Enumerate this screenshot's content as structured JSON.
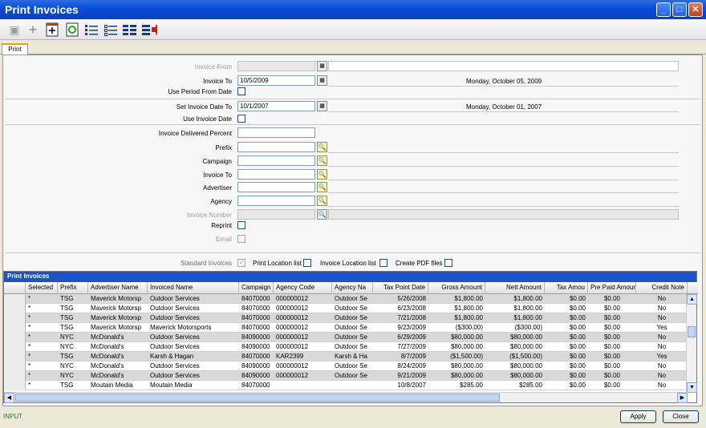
{
  "window": {
    "title": "Print Invoices"
  },
  "tab": {
    "label": "Print"
  },
  "form": {
    "invoice_from_label": "Invoice From",
    "invoice_to_label": "Invoice To",
    "invoice_to_value": "10/5/2009",
    "invoice_to_text": "Monday, October 05, 2009",
    "use_period_label": "Use Period From Date",
    "set_invoice_date_label": "Set Invoice Date To",
    "set_invoice_date_value": "10/1/2007",
    "set_invoice_date_text": "Monday, October 01, 2007",
    "use_invoice_date_label": "Use Invoice Date",
    "delivered_percent_label": "Invoice Delivered Percent",
    "prefix_label": "Prefix",
    "campaign_label": "Campaign",
    "invoice_to2_label": "Invoice To",
    "advertiser_label": "Advertiser",
    "agency_label": "Agency",
    "invoice_number_label": "Invoice Number",
    "reprint_label": "Reprint",
    "email_label": "Email",
    "standard_invoices_label": "Standard Invoices",
    "print_location_label": "Print Location list",
    "invoice_location_label": "Invoice Location list",
    "create_pdf_label": "Create PDF files"
  },
  "grid": {
    "title": "Print Invoices",
    "columns": [
      "Selected",
      "Prefix",
      "Advertiser Name",
      "Invoiced Name",
      "Campaign",
      "Agency Code",
      "Agency Na",
      "Tax Point Date",
      "Gross Amount",
      "Nett Amount",
      "Tax Amou",
      "Pre Paid Amount",
      "Credit Note"
    ],
    "rows": [
      [
        "*",
        "TSG",
        "Maverick Motorsp",
        "Outdoor Services",
        "84070000",
        "000000012",
        "Outdoor Se",
        "5/26/2008",
        "$1,800.00",
        "$1,800.00",
        "$0.00",
        "$0.00",
        "No"
      ],
      [
        "*",
        "TSG",
        "Maverick Motorsp",
        "Outdoor Services",
        "84070000",
        "000000012",
        "Outdoor Se",
        "6/23/2008",
        "$1,800.00",
        "$1,800.00",
        "$0.00",
        "$0.00",
        "No"
      ],
      [
        "*",
        "TSG",
        "Maverick Motorsp",
        "Outdoor Services",
        "84070000",
        "000000012",
        "Outdoor Se",
        "7/21/2008",
        "$1,800.00",
        "$1,800.00",
        "$0.00",
        "$0.00",
        "No"
      ],
      [
        "*",
        "TSG",
        "Maverick Motorsp",
        "Maverick Motorsports",
        "84070000",
        "000000012",
        "Outdoor Se",
        "9/23/2009",
        "($300.00)",
        "($300.00)",
        "$0.00",
        "$0.00",
        "Yes"
      ],
      [
        "*",
        "NYC",
        "McDonald's",
        "Outdoor Services",
        "84090000",
        "000000012",
        "Outdoor Se",
        "6/29/2009",
        "$80,000.00",
        "$80,000.00",
        "$0.00",
        "$0.00",
        "No"
      ],
      [
        "*",
        "NYC",
        "McDonald's",
        "Outdoor Services",
        "84090000",
        "000000012",
        "Outdoor Se",
        "7/27/2009",
        "$80,000.00",
        "$80,000.00",
        "$0.00",
        "$0.00",
        "No"
      ],
      [
        "*",
        "TSG",
        "McDonald's",
        "Karsh & Hagan",
        "84070000",
        "KAR2399",
        "Karsh & Ha",
        "8/7/2009",
        "($1,500.00)",
        "($1,500.00)",
        "$0.00",
        "$0.00",
        "Yes"
      ],
      [
        "*",
        "NYC",
        "McDonald's",
        "Outdoor Services",
        "84090000",
        "000000012",
        "Outdoor Se",
        "8/24/2009",
        "$80,000.00",
        "$80,000.00",
        "$0.00",
        "$0.00",
        "No"
      ],
      [
        "*",
        "NYC",
        "McDonald's",
        "Outdoor Services",
        "84090000",
        "000000012",
        "Outdoor Se",
        "9/21/2009",
        "$80,000.00",
        "$80,000.00",
        "$0.00",
        "$0.00",
        "No"
      ],
      [
        "*",
        "TSG",
        "Moutain Media",
        "Moutain Media",
        "84070000",
        "",
        "",
        "10/8/2007",
        "$285.00",
        "$285.00",
        "$0.00",
        "$0.00",
        "No"
      ]
    ]
  },
  "status": {
    "text": "INPUT"
  },
  "buttons": {
    "apply": "Apply",
    "close": "Close"
  }
}
